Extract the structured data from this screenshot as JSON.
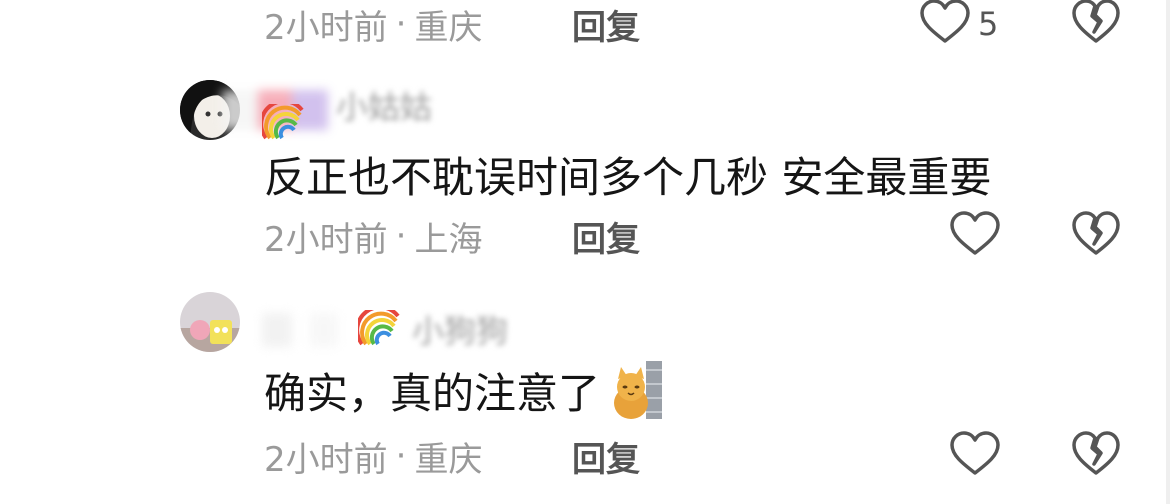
{
  "comments": [
    {
      "time": "2小时前",
      "separator": "·",
      "location": "重庆",
      "reply_label": "回复",
      "like_count": "5"
    },
    {
      "username": "小姑姑",
      "text": "反正也不耽误时间多个几秒 安全最重要",
      "time": "2小时前",
      "separator": "·",
      "location": "上海",
      "reply_label": "回复"
    },
    {
      "username": "小狗狗",
      "text": "确实，真的注意了",
      "time": "2小时前",
      "separator": "·",
      "location": "重庆",
      "reply_label": "回复"
    }
  ],
  "icons": {
    "like": "heart-outline-icon",
    "dislike": "broken-heart-icon",
    "emoji": "cat-emoji-icon",
    "badge": "rainbow-icon"
  },
  "colors": {
    "meta_text": "#9a9a9a",
    "reply_text": "#555555",
    "comment_text": "#151515"
  }
}
